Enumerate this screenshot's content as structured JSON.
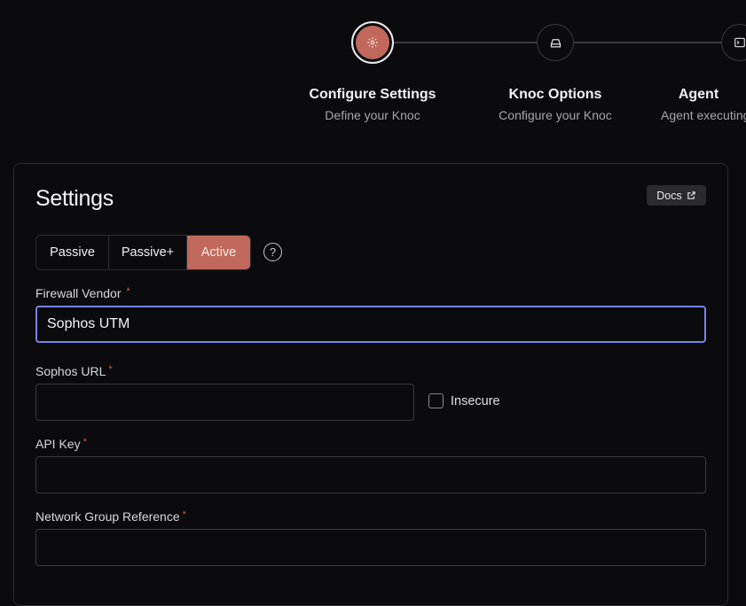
{
  "stepper": {
    "steps": [
      {
        "title": "Configure Settings",
        "subtitle": "Define your Knoc",
        "icon": "gear-icon",
        "active": true
      },
      {
        "title": "Knoc Options",
        "subtitle": "Configure your Knoc",
        "icon": "drive-icon",
        "active": false
      },
      {
        "title": "Agent",
        "subtitle": "Agent executing",
        "icon": "terminal-icon",
        "active": false
      }
    ]
  },
  "settings": {
    "title": "Settings",
    "docs_label": "Docs",
    "modes": [
      "Passive",
      "Passive+",
      "Active"
    ],
    "selected_mode": "Active",
    "help_glyph": "?"
  },
  "form": {
    "firewall_vendor": {
      "label": "Firewall Vendor",
      "value": "Sophos UTM",
      "required": "*"
    },
    "sophos_url": {
      "label": "Sophos URL",
      "value": "",
      "required": "*"
    },
    "insecure": {
      "label": "Insecure",
      "checked": false
    },
    "api_key": {
      "label": "API Key",
      "value": "",
      "required": "*"
    },
    "network_group_reference": {
      "label": "Network Group Reference",
      "value": "",
      "required": "*"
    }
  },
  "colors": {
    "accent": "#c0685c",
    "focus": "#7b82e8",
    "required": "#d0574b",
    "background": "#0b0b0d"
  }
}
